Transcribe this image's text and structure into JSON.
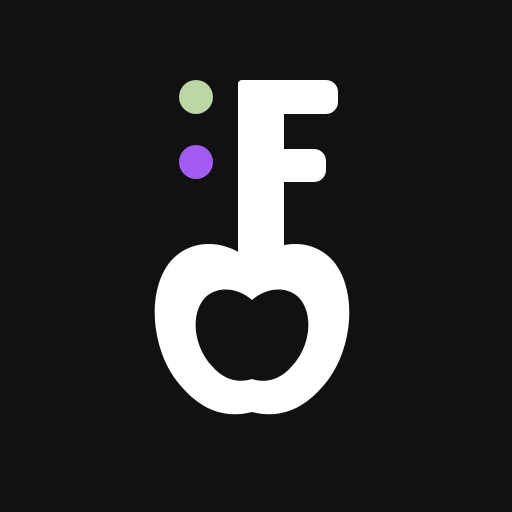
{
  "app_icon": {
    "icon": "key-apple-logo-icon",
    "colors": {
      "background": "#111111",
      "glyph": "#ffffff",
      "dot_top": "#bcd6a4",
      "dot_bottom": "#a35cf2"
    }
  }
}
